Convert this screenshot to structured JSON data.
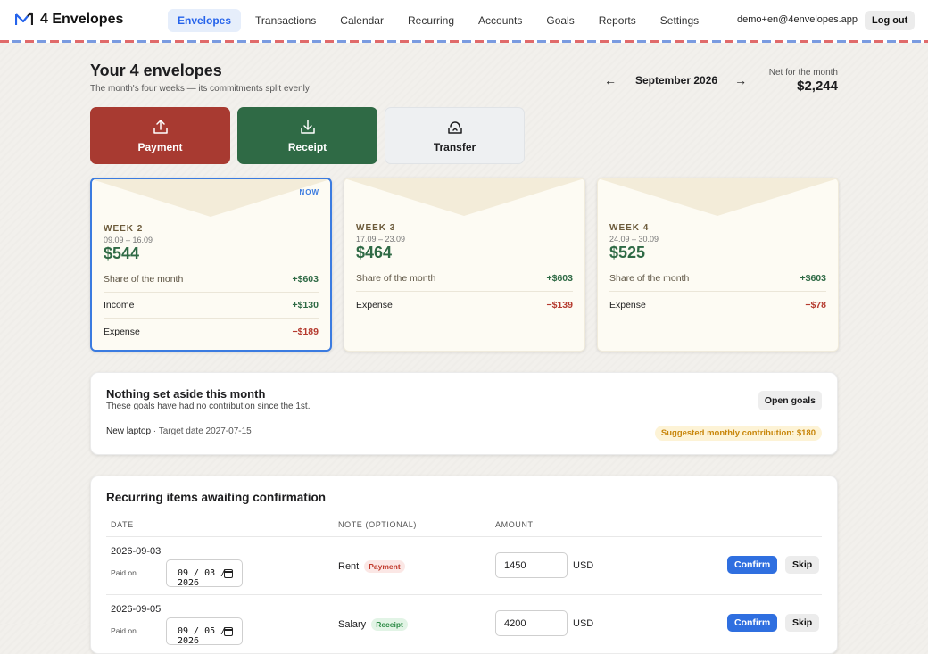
{
  "app": {
    "name": "4 Envelopes"
  },
  "nav": {
    "items": [
      {
        "label": "Envelopes",
        "active": true
      },
      {
        "label": "Transactions"
      },
      {
        "label": "Calendar"
      },
      {
        "label": "Recurring"
      },
      {
        "label": "Accounts"
      },
      {
        "label": "Goals"
      },
      {
        "label": "Reports"
      },
      {
        "label": "Settings"
      }
    ],
    "user_email": "demo+en@4envelopes.app",
    "logout_label": "Log out"
  },
  "page": {
    "title": "Your 4 envelopes",
    "subtitle": "The month's four weeks — its commitments split evenly",
    "prev_arrow": "←",
    "next_arrow": "→",
    "month": "September 2026",
    "net_label": "Net for the month",
    "net_value": "$2,244"
  },
  "actions": {
    "payment": "Payment",
    "receipt": "Receipt",
    "transfer": "Transfer"
  },
  "envelopes": [
    {
      "week": "WEEK 2",
      "dates": "09.09 – 16.09",
      "total": "$544",
      "badge": "NOW",
      "rows": [
        {
          "label": "Share of the month",
          "value": "+$603"
        },
        {
          "label": "Income",
          "value": "+$130"
        },
        {
          "label": "Expense",
          "value": "−$189"
        }
      ]
    },
    {
      "week": "WEEK 3",
      "dates": "17.09 – 23.09",
      "total": "$464",
      "rows": [
        {
          "label": "Share of the month",
          "value": "+$603"
        },
        {
          "label": "Expense",
          "value": "−$139"
        }
      ]
    },
    {
      "week": "WEEK 4",
      "dates": "24.09 – 30.09",
      "total": "$525",
      "rows": [
        {
          "label": "Share of the month",
          "value": "+$603"
        },
        {
          "label": "Expense",
          "value": "−$78"
        }
      ]
    }
  ],
  "goals": {
    "title": "Nothing set aside this month",
    "subtitle": "These goals have had no contribution since the 1st.",
    "open_label": "Open goals",
    "goal_name": "New laptop",
    "goal_target": " · Target date 2027-07-15",
    "suggestion": "Suggested monthly contribution: $180"
  },
  "recurring": {
    "title": "Recurring items awaiting confirmation",
    "headers": {
      "date": "DATE",
      "note": "NOTE (OPTIONAL)",
      "amount": "AMOUNT"
    },
    "rows": [
      {
        "date": "2026-09-03",
        "paid_on_label": "Paid on",
        "paid_on": "09 / 03 / 2026",
        "note": "Rent",
        "tag": "Payment",
        "amount": "1450",
        "currency": "USD",
        "confirm": "Confirm",
        "skip": "Skip"
      },
      {
        "date": "2026-09-05",
        "paid_on_label": "Paid on",
        "paid_on": "09 / 05 / 2026",
        "note": "Salary",
        "tag": "Receipt",
        "amount": "4200",
        "currency": "USD",
        "confirm": "Confirm",
        "skip": "Skip"
      }
    ]
  },
  "colors": {
    "accent": "#2563eb",
    "payment": "#a83a31",
    "receipt": "#2f6a45",
    "positive": "#2f6a45",
    "negative": "#b53a2e",
    "warning": "#c8860b"
  }
}
